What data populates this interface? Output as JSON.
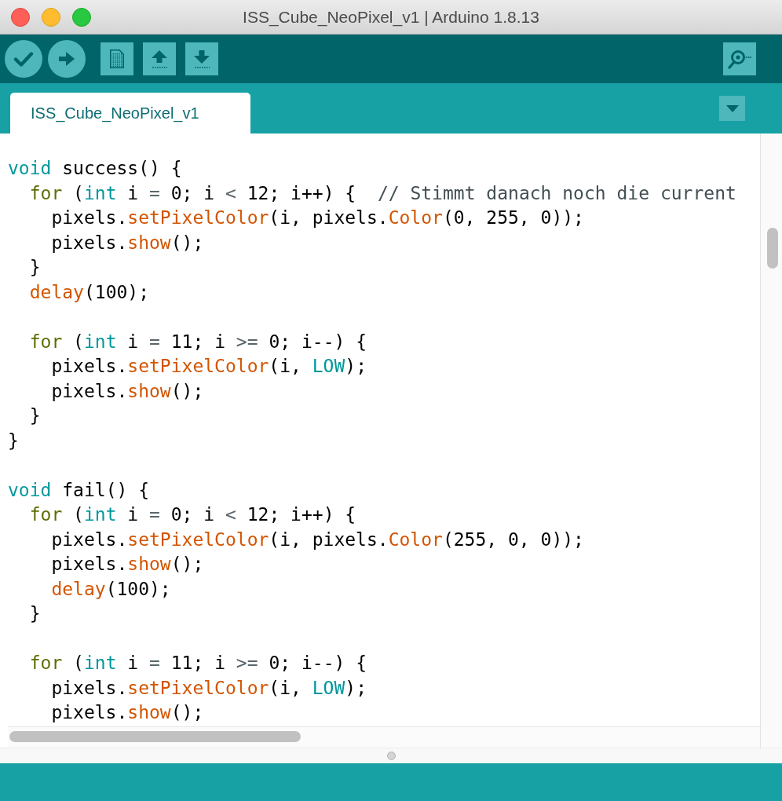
{
  "window": {
    "title": "ISS_Cube_NeoPixel_v1 | Arduino 1.8.13"
  },
  "toolbar": {
    "left": [
      {
        "kind": "verify"
      },
      {
        "kind": "upload"
      },
      {
        "kind": "new"
      },
      {
        "kind": "open"
      },
      {
        "kind": "save"
      }
    ],
    "right": [
      {
        "kind": "monitor"
      }
    ]
  },
  "tabs": [
    {
      "label": "ISS_Cube_NeoPixel_v1",
      "selected": true
    }
  ],
  "editor": {
    "blocks": [
      {
        "lines": [
          {
            "tokens": [
              {
                "text": "void",
                "kind": "type"
              },
              {
                "text": " success() {",
                "kind": "plain"
              }
            ]
          },
          {
            "tokens": [
              {
                "text": "  for",
                "kind": "control"
              },
              {
                "text": " (",
                "kind": "plain"
              },
              {
                "text": "int",
                "kind": "type"
              },
              {
                "text": " i ",
                "kind": "plain"
              },
              {
                "text": "=",
                "kind": "operator"
              },
              {
                "text": " 0; i ",
                "kind": "plain"
              },
              {
                "text": "<",
                "kind": "operator"
              },
              {
                "text": " 12; i++) {  ",
                "kind": "plain"
              },
              {
                "text": "// Stimmt danach noch die current",
                "kind": "comment"
              }
            ]
          },
          {
            "tokens": [
              {
                "text": "    pixels.",
                "kind": "plain"
              },
              {
                "text": "setPixelColor",
                "kind": "function"
              },
              {
                "text": "(i, pixels.",
                "kind": "plain"
              },
              {
                "text": "Color",
                "kind": "function"
              },
              {
                "text": "(0, 255, 0));",
                "kind": "plain"
              }
            ]
          },
          {
            "tokens": [
              {
                "text": "    pixels.",
                "kind": "plain"
              },
              {
                "text": "show",
                "kind": "function"
              },
              {
                "text": "();",
                "kind": "plain"
              }
            ]
          },
          {
            "tokens": [
              {
                "text": "  }",
                "kind": "plain"
              }
            ]
          },
          {
            "tokens": [
              {
                "text": "  delay",
                "kind": "function"
              },
              {
                "text": "(100);",
                "kind": "plain"
              }
            ]
          }
        ]
      },
      {
        "lines": [
          {
            "tokens": [
              {
                "text": "  for",
                "kind": "control"
              },
              {
                "text": " (",
                "kind": "plain"
              },
              {
                "text": "int",
                "kind": "type"
              },
              {
                "text": " i ",
                "kind": "plain"
              },
              {
                "text": "=",
                "kind": "operator"
              },
              {
                "text": " 11; i ",
                "kind": "plain"
              },
              {
                "text": ">=",
                "kind": "operator"
              },
              {
                "text": " 0; i--) {",
                "kind": "plain"
              }
            ]
          },
          {
            "tokens": [
              {
                "text": "    pixels.",
                "kind": "plain"
              },
              {
                "text": "setPixelColor",
                "kind": "function"
              },
              {
                "text": "(i, ",
                "kind": "plain"
              },
              {
                "text": "LOW",
                "kind": "type"
              },
              {
                "text": ");",
                "kind": "plain"
              }
            ]
          },
          {
            "tokens": [
              {
                "text": "    pixels.",
                "kind": "plain"
              },
              {
                "text": "show",
                "kind": "function"
              },
              {
                "text": "();",
                "kind": "plain"
              }
            ]
          },
          {
            "tokens": [
              {
                "text": "  }",
                "kind": "plain"
              }
            ]
          },
          {
            "tokens": [
              {
                "text": "}",
                "kind": "plain"
              }
            ]
          }
        ]
      },
      {
        "lines": [
          {
            "tokens": [
              {
                "text": "void",
                "kind": "type"
              },
              {
                "text": " fail() {",
                "kind": "plain"
              }
            ]
          },
          {
            "tokens": [
              {
                "text": "  for",
                "kind": "control"
              },
              {
                "text": " (",
                "kind": "plain"
              },
              {
                "text": "int",
                "kind": "type"
              },
              {
                "text": " i ",
                "kind": "plain"
              },
              {
                "text": "=",
                "kind": "operator"
              },
              {
                "text": " 0; i ",
                "kind": "plain"
              },
              {
                "text": "<",
                "kind": "operator"
              },
              {
                "text": " 12; i++) {",
                "kind": "plain"
              }
            ]
          },
          {
            "tokens": [
              {
                "text": "    pixels.",
                "kind": "plain"
              },
              {
                "text": "setPixelColor",
                "kind": "function"
              },
              {
                "text": "(i, pixels.",
                "kind": "plain"
              },
              {
                "text": "Color",
                "kind": "function"
              },
              {
                "text": "(255, 0, 0));",
                "kind": "plain"
              }
            ]
          },
          {
            "tokens": [
              {
                "text": "    pixels.",
                "kind": "plain"
              },
              {
                "text": "show",
                "kind": "function"
              },
              {
                "text": "();",
                "kind": "plain"
              }
            ]
          },
          {
            "tokens": [
              {
                "text": "    delay",
                "kind": "function"
              },
              {
                "text": "(100);",
                "kind": "plain"
              }
            ]
          },
          {
            "tokens": [
              {
                "text": "  }",
                "kind": "plain"
              }
            ]
          }
        ]
      },
      {
        "lines": [
          {
            "tokens": [
              {
                "text": "  for",
                "kind": "control"
              },
              {
                "text": " (",
                "kind": "plain"
              },
              {
                "text": "int",
                "kind": "type"
              },
              {
                "text": " i ",
                "kind": "plain"
              },
              {
                "text": "=",
                "kind": "operator"
              },
              {
                "text": " 11; i ",
                "kind": "plain"
              },
              {
                "text": ">=",
                "kind": "operator"
              },
              {
                "text": " 0; i--) {",
                "kind": "plain"
              }
            ]
          },
          {
            "tokens": [
              {
                "text": "    pixels.",
                "kind": "plain"
              },
              {
                "text": "setPixelColor",
                "kind": "function"
              },
              {
                "text": "(i, ",
                "kind": "plain"
              },
              {
                "text": "LOW",
                "kind": "type"
              },
              {
                "text": ");",
                "kind": "plain"
              }
            ]
          },
          {
            "tokens": [
              {
                "text": "    pixels.",
                "kind": "plain"
              },
              {
                "text": "show",
                "kind": "function"
              },
              {
                "text": "();",
                "kind": "plain"
              }
            ]
          }
        ]
      }
    ]
  }
}
